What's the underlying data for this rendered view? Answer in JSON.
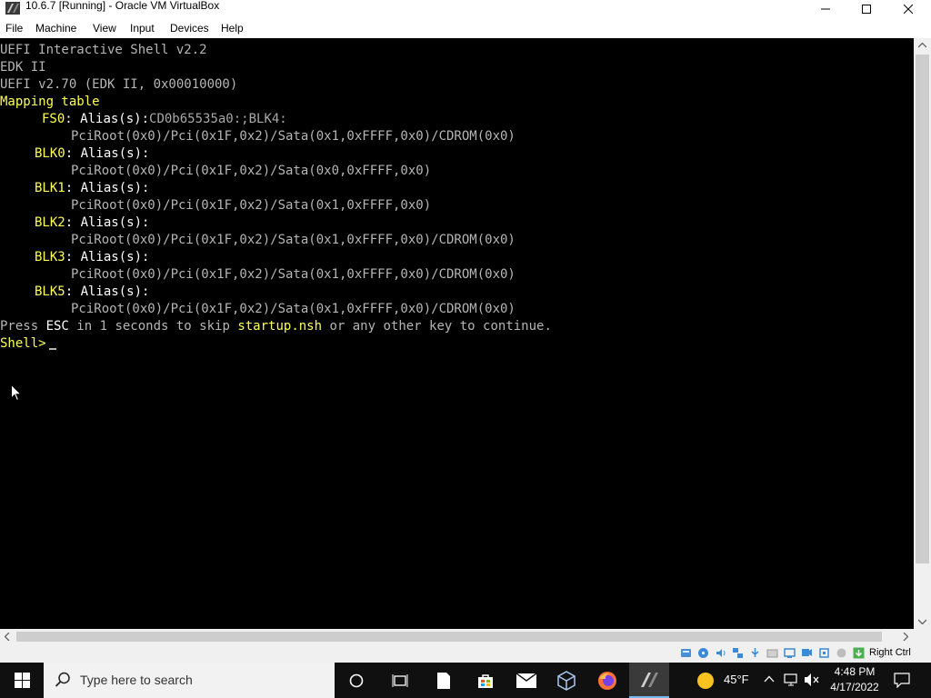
{
  "window": {
    "title": "10.6.7 [Running] - Oracle VM VirtualBox"
  },
  "menu": [
    "File",
    "Machine",
    "View",
    "Input",
    "Devices",
    "Help"
  ],
  "console": {
    "header": [
      "UEFI Interactive Shell v2.2",
      "EDK II",
      "UEFI v2.70 (EDK II, 0x00010000)"
    ],
    "mapping_title": "Mapping table",
    "entries": [
      {
        "name": "FS0",
        "alias": "Alias(s):",
        "alias_value": "CD0b65535a0:;BLK4:",
        "path": "PciRoot(0x0)/Pci(0x1F,0x2)/Sata(0x1,0xFFFF,0x0)/CDROM(0x0)"
      },
      {
        "name": "BLK0",
        "alias": "Alias(s):",
        "alias_value": "",
        "path": "PciRoot(0x0)/Pci(0x1F,0x2)/Sata(0x0,0xFFFF,0x0)"
      },
      {
        "name": "BLK1",
        "alias": "Alias(s):",
        "alias_value": "",
        "path": "PciRoot(0x0)/Pci(0x1F,0x2)/Sata(0x1,0xFFFF,0x0)"
      },
      {
        "name": "BLK2",
        "alias": "Alias(s):",
        "alias_value": "",
        "path": "PciRoot(0x0)/Pci(0x1F,0x2)/Sata(0x1,0xFFFF,0x0)/CDROM(0x0)"
      },
      {
        "name": "BLK3",
        "alias": "Alias(s):",
        "alias_value": "",
        "path": "PciRoot(0x0)/Pci(0x1F,0x2)/Sata(0x1,0xFFFF,0x0)/CDROM(0x0)"
      },
      {
        "name": "BLK5",
        "alias": "Alias(s):",
        "alias_value": "",
        "path": "PciRoot(0x0)/Pci(0x1F,0x2)/Sata(0x1,0xFFFF,0x0)/CDROM(0x0)"
      }
    ],
    "press_1": "Press ",
    "press_esc": "ESC",
    "press_2": " in 1 seconds to skip ",
    "press_file": "startup.nsh",
    "press_3": " or any other key to continue.",
    "prompt": "Shell> "
  },
  "statusbar": {
    "host_key": "Right Ctrl"
  },
  "taskbar": {
    "search_placeholder": "Type here to search",
    "temperature": "45°F",
    "time": "4:48 PM",
    "date": "4/17/2022"
  }
}
